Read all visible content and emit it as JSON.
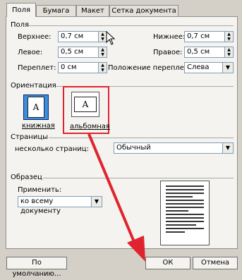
{
  "tabs": [
    {
      "label": "Поля"
    },
    {
      "label": "Бумага"
    },
    {
      "label": "Макет"
    },
    {
      "label": "Сетка документа"
    }
  ],
  "margins": {
    "section": "Поля",
    "top": {
      "label": "Верхнее:",
      "value": "0,7 см"
    },
    "bottom": {
      "label": "Нижнее:",
      "value": "0,7 см"
    },
    "left": {
      "label": "Левое:",
      "value": "0,5 см"
    },
    "right": {
      "label": "Правое:",
      "value": "0,5 см"
    },
    "gutter": {
      "label": "Переплет:",
      "value": "0 см"
    },
    "gutter_pos": {
      "label": "Положение переплета:",
      "value": "Слева"
    }
  },
  "orientation": {
    "section": "Ориентация",
    "portrait": {
      "label": "книжная",
      "glyph": "A"
    },
    "landscape": {
      "label": "альбомная",
      "glyph": "A"
    }
  },
  "pages": {
    "section": "Страницы",
    "label": "несколько страниц:",
    "value": "Обычный"
  },
  "sample": {
    "section": "Образец",
    "apply_label": "Применить:",
    "apply_value": "ко всему документу"
  },
  "buttons": {
    "default": "По умолчанию...",
    "ok": "ОК",
    "cancel": "Отмена"
  },
  "colors": {
    "highlight": "#e0242f",
    "accent": "#0a246a"
  }
}
